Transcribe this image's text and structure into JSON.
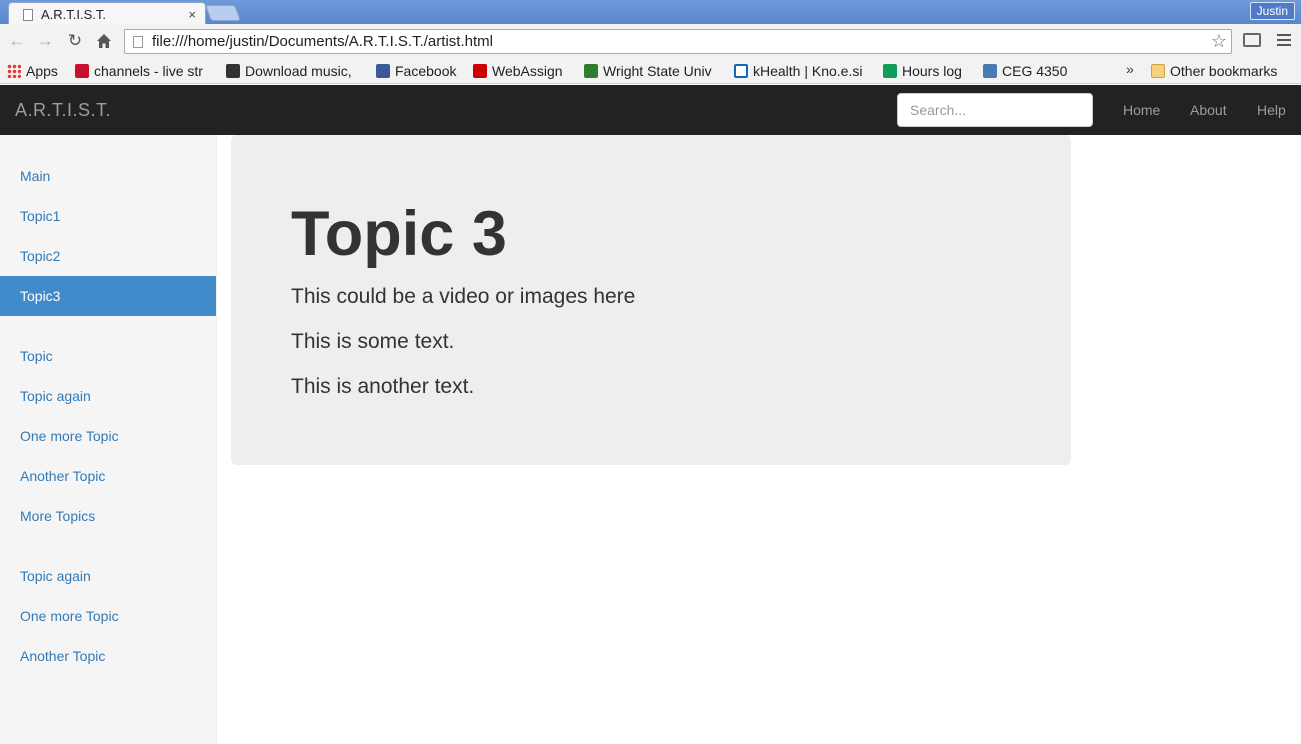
{
  "browser": {
    "tab_title": "A.R.T.I.S.T.",
    "tab_close": "×",
    "profile_name": "Justin",
    "url": "file:///home/justin/Documents/A.R.T.I.S.T./artist.html",
    "bookmarks": [
      {
        "label": "Apps",
        "icon": "apps-grid-icon",
        "color": "#e0a000"
      },
      {
        "label": "channels - live str",
        "icon": "v-logo-icon",
        "color": "#c8102e"
      },
      {
        "label": "Download music,",
        "icon": "download-icon",
        "color": "#333333"
      },
      {
        "label": "Facebook",
        "icon": "facebook-icon",
        "color": "#3b5998"
      },
      {
        "label": "WebAssign",
        "icon": "webassign-icon",
        "color": "#cc0000"
      },
      {
        "label": "Wright State Univ",
        "icon": "wright-state-icon",
        "color": "#2e7d32"
      },
      {
        "label": "kHealth | Kno.e.si",
        "icon": "khealth-icon",
        "color": "#1565c0"
      },
      {
        "label": "Hours log",
        "icon": "sheets-icon",
        "color": "#0f9d58"
      },
      {
        "label": "CEG 4350",
        "icon": "p-logo-icon",
        "color": "#4a7ab5"
      }
    ],
    "bookmarks_overflow": "»",
    "other_bookmarks": "Other bookmarks"
  },
  "navbar": {
    "brand": "A.R.T.I.S.T.",
    "search_placeholder": "Search...",
    "links": [
      "Home",
      "About",
      "Help"
    ]
  },
  "sidebar": {
    "groups": [
      [
        {
          "label": "Main",
          "active": false
        },
        {
          "label": "Topic1",
          "active": false
        },
        {
          "label": "Topic2",
          "active": false
        },
        {
          "label": "Topic3",
          "active": true
        }
      ],
      [
        {
          "label": "Topic",
          "active": false
        },
        {
          "label": "Topic again",
          "active": false
        },
        {
          "label": "One more Topic",
          "active": false
        },
        {
          "label": "Another Topic",
          "active": false
        },
        {
          "label": "More Topics",
          "active": false
        }
      ],
      [
        {
          "label": "Topic again",
          "active": false
        },
        {
          "label": "One more Topic",
          "active": false
        },
        {
          "label": "Another Topic",
          "active": false
        }
      ]
    ]
  },
  "main": {
    "title": "Topic 3",
    "paragraphs": [
      "This could be a video or images here",
      "This is some text.",
      "This is another text."
    ]
  }
}
